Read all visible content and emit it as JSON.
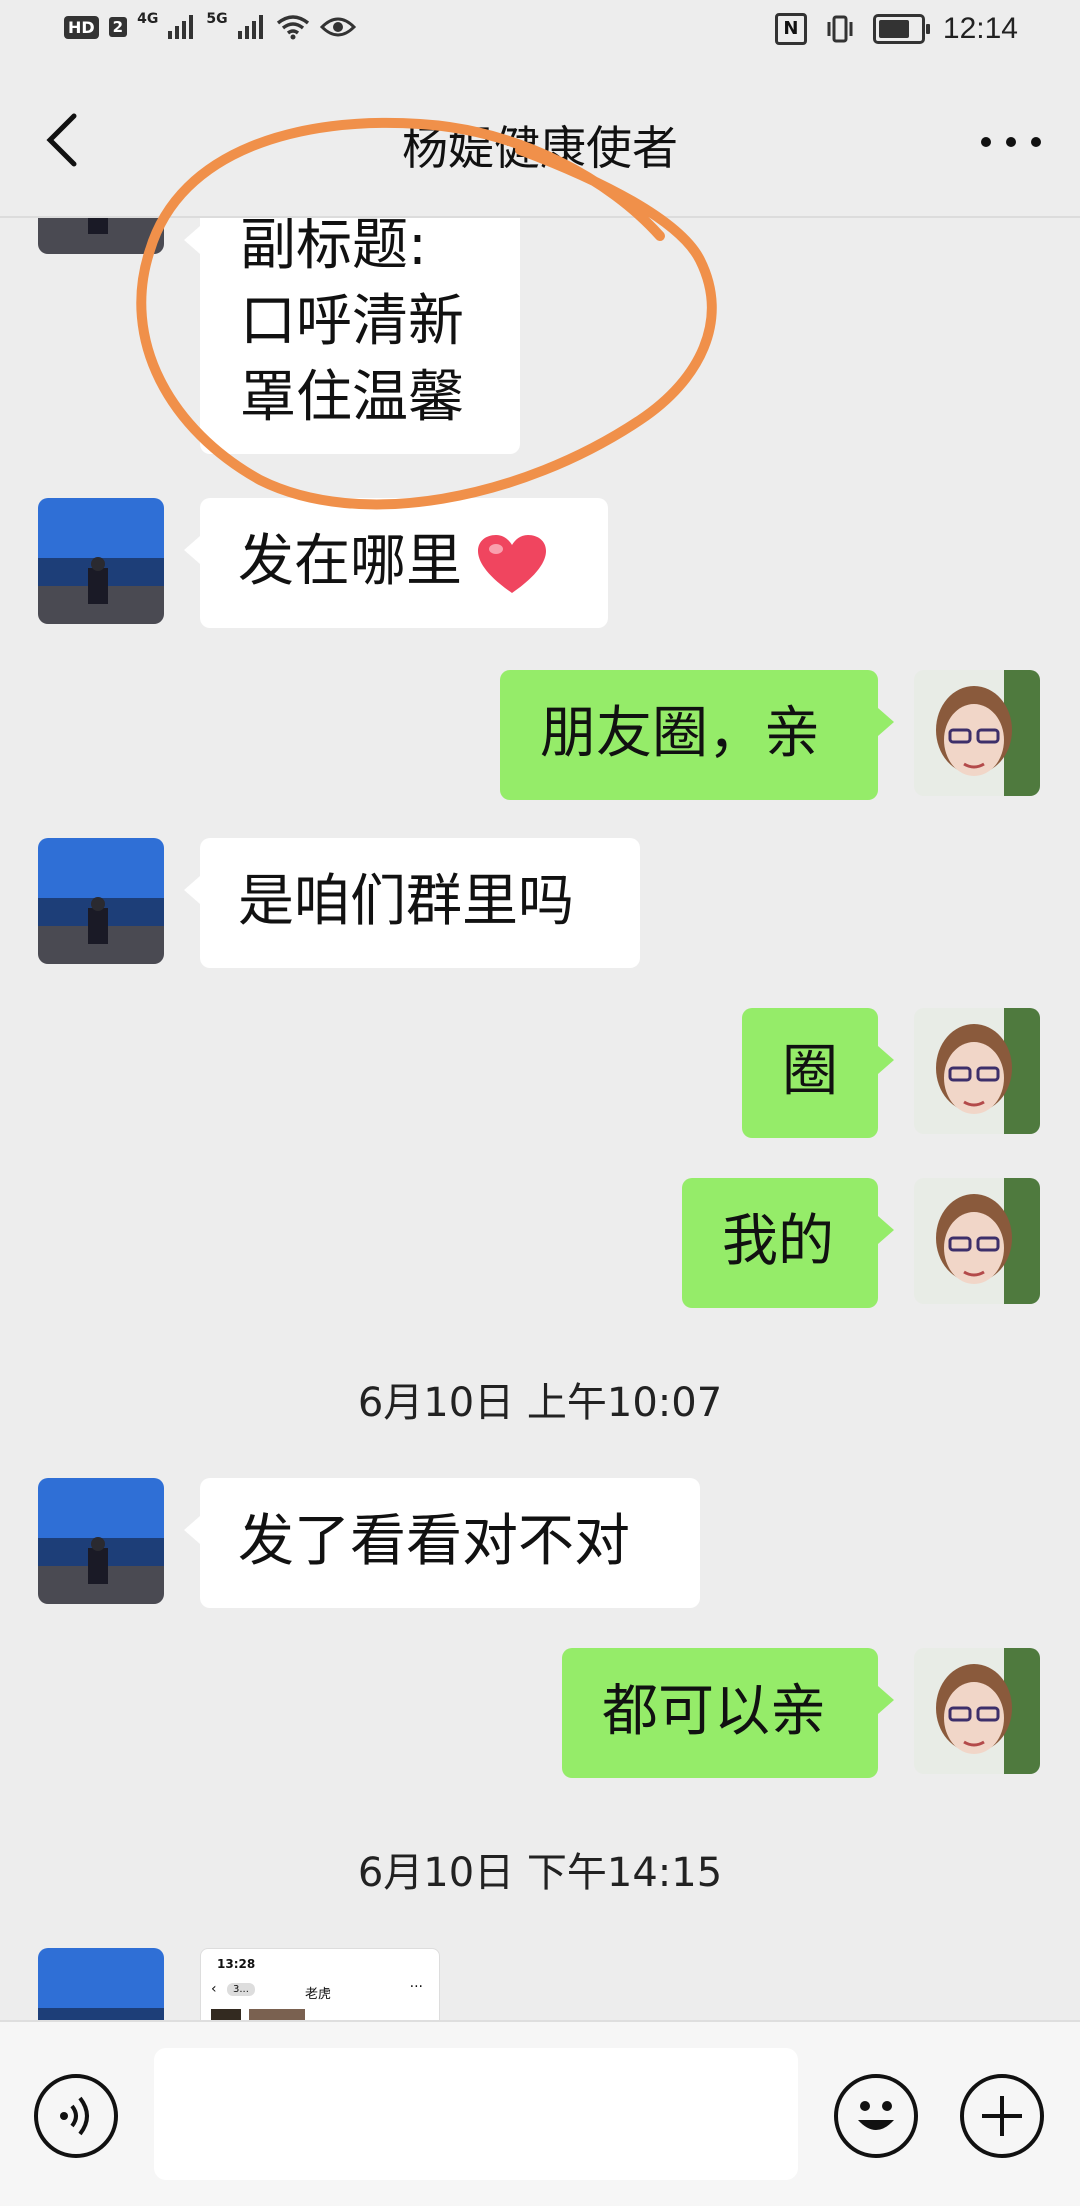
{
  "status_bar": {
    "hd": "HD",
    "sim": "2",
    "net1": "4G",
    "net2": "5G",
    "nfc": "N",
    "time": "12:14"
  },
  "header": {
    "title": "杨媞健康使者",
    "back_icon": "chevron-left-icon",
    "more_icon": "more-dots-icon"
  },
  "messages": [
    {
      "side": "in",
      "lines": [
        "副标题:",
        "口呼清新",
        "罩住温馨"
      ]
    },
    {
      "side": "in",
      "text": "发在哪里",
      "emoji": "heart-emoji"
    },
    {
      "side": "out",
      "text": "朋友圈，亲"
    },
    {
      "side": "in",
      "text": "是咱们群里吗"
    },
    {
      "side": "out",
      "text": "圈"
    },
    {
      "side": "out",
      "text": "我的"
    },
    {
      "side": "in",
      "text": "发了看看对不对"
    },
    {
      "side": "out",
      "text": "都可以亲"
    }
  ],
  "timestamps": [
    "6月10日 上午10:07",
    "6月10日 下午14:15"
  ],
  "shared_screenshot": {
    "time": "13:28",
    "chip": "3...",
    "name": "老虎",
    "dots": "···"
  },
  "input_bar": {
    "value": "",
    "voice_icon": "voice-icon",
    "emoji_icon": "emoji-icon",
    "plus_icon": "plus-icon"
  },
  "colors": {
    "background": "#ededed",
    "bubble_in": "#ffffff",
    "bubble_out": "#95ec69",
    "annotation": "#f0904a"
  }
}
